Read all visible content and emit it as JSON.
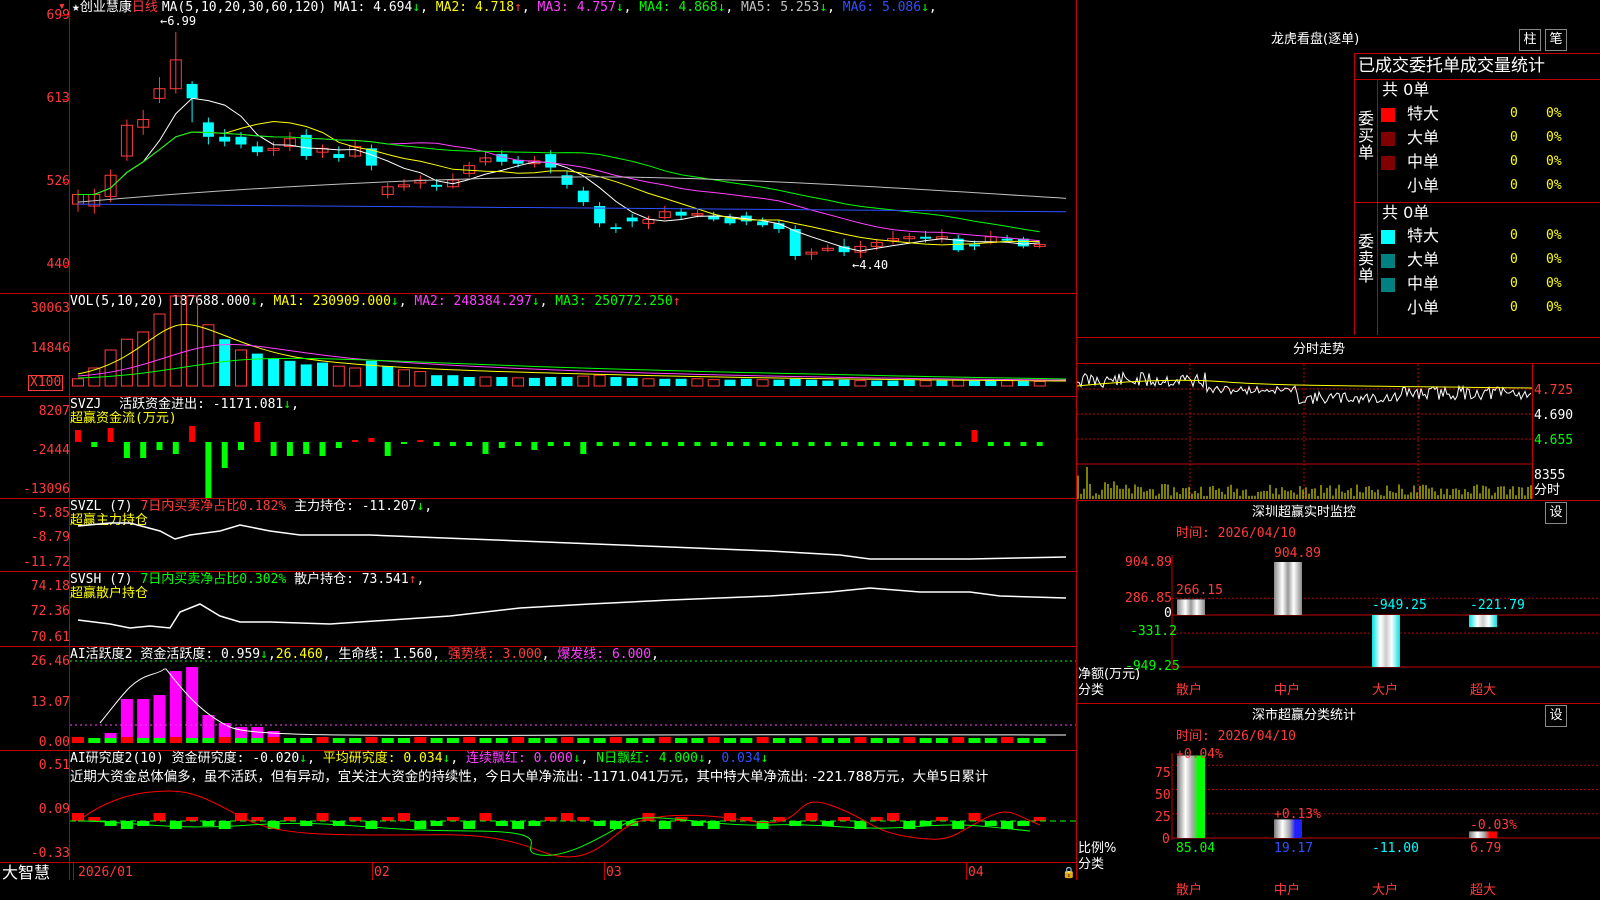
{
  "main": {
    "corner_mark": "▾",
    "y_ticks": [
      "699",
      "613",
      "526",
      "440"
    ],
    "stock_name": "★创业慧康",
    "period": "日线",
    "ma_header": "MA(5,10,20,30,60,120)",
    "ma": [
      {
        "label": "MA1:",
        "value": "4.694",
        "arrow": "↓",
        "color": "#ffffff"
      },
      {
        "label": "MA2:",
        "value": "4.718",
        "arrow": "↑",
        "color": "#ffff00"
      },
      {
        "label": "MA3:",
        "value": "4.757",
        "arrow": "↓",
        "color": "#ff40ff"
      },
      {
        "label": "MA4:",
        "value": "4.868",
        "arrow": "↓",
        "color": "#00ff00"
      },
      {
        "label": "MA5:",
        "value": "5.253",
        "arrow": "↓",
        "color": "#c0c0c0"
      },
      {
        "label": "MA6:",
        "value": "5.086",
        "arrow": "↓",
        "color": "#3050ff"
      }
    ],
    "high_marker": "6.99",
    "low_marker": "4.40"
  },
  "vol": {
    "header": "VOL(5,10,20)",
    "value": "187688.000",
    "value_arrow": "↓",
    "ma1": "MA1: 230909.000",
    "ma1_arrow": "↓",
    "ma2": "MA2: 248384.297",
    "ma2_arrow": "↓",
    "ma3": "MA3: 250772.250",
    "ma3_arrow": "↑",
    "y_ticks": [
      "30063",
      "14846"
    ],
    "unit": "X100"
  },
  "svzj": {
    "header": "SVZJ",
    "label": "活跃资金进出: -1171.081",
    "arrow": "↓",
    "comma": ",",
    "title": "超赢资金流(万元)",
    "y_ticks": [
      "8207",
      "-2444",
      "-13096"
    ]
  },
  "svzl": {
    "header": "SVZL (7)",
    "ratio": "7日内买卖净占比0.182%",
    "hold": "主力持仓: -11.207",
    "arrow": "↓",
    "comma": ",",
    "title": "超赢主力持仓",
    "y_ticks": [
      "-5.85",
      "-8.79",
      "-11.72"
    ]
  },
  "svsh": {
    "header": "SVSH (7)",
    "ratio": "7日内买卖净占比0.302%",
    "hold": "散户持仓: 73.541",
    "arrow": "↑",
    "comma": ",",
    "title": "超赢散户持仓",
    "y_ticks": [
      "74.18",
      "72.36",
      "70.61"
    ]
  },
  "ai1": {
    "header": "AI活跃度2",
    "label": "资金活跃度: 0.959",
    "arrow1": "↓",
    "v2": "26.460",
    "comma": ",",
    "life": "生命线: 1.560",
    "strong": "强势线: 3.000",
    "burst": "爆发线: 6.000",
    "tail": ",",
    "y_ticks": [
      "26.46",
      "13.07",
      "0.00"
    ]
  },
  "ai2": {
    "header": "AI研究度2(10)",
    "label": "资金研究度: -0.020",
    "arrow1": "↓",
    "avg": "平均研究度: 0.034",
    "arrow2": "↓",
    "lianxu": "连续飘红: 0.000",
    "arrow3": "↓",
    "nday": "N日飘红: 4.000",
    "arrow4": "↓",
    "last": "0.034",
    "arrow5": "↓",
    "comment": "近期大资金总体偏多，虽不活跃，但有异动，宜关注大资金的持续性，今日大单净流出: -1171.041万元，其中特大单净流出: -221.788万元，大单5日累计",
    "y_ticks": [
      "0.51",
      "0.09",
      "-0.33"
    ]
  },
  "xaxis": {
    "brand": "大智慧",
    "labels": [
      "2026/01",
      "02",
      "03",
      "04"
    ]
  },
  "lhb": {
    "title": "龙虎看盘(逐单)",
    "btn1": "柱",
    "btn2": "笔",
    "table_title": "已成交委托单成交量统计",
    "buy_side": "委买单",
    "sell_side": "委卖单",
    "buy_total": "共 0单",
    "sell_total": "共 0单",
    "rows": [
      {
        "label": "特大",
        "count": "0",
        "pct": "0%"
      },
      {
        "label": "大单",
        "count": "0",
        "pct": "0%"
      },
      {
        "label": "中单",
        "count": "0",
        "pct": "0%"
      },
      {
        "label": "小单",
        "count": "0",
        "pct": "0%"
      }
    ],
    "buy_colors": [
      "#ff0000",
      "#800000",
      "#800000",
      ""
    ],
    "sell_colors": [
      "#00ffff",
      "#008080",
      "#008080",
      ""
    ]
  },
  "intraday": {
    "title": "分时走势",
    "y_ticks": [
      "4.725",
      "4.690",
      "4.655"
    ],
    "vol_tick": "8355",
    "vol_label": "分时"
  },
  "monitor": {
    "title": "深圳超赢实时监控",
    "set": "设",
    "time": "时间: 2026/04/10",
    "y_ticks": [
      "904.89",
      "286.85",
      "0",
      "-331.2",
      "-949.25"
    ],
    "axis_title": "净额(万元)",
    "cat_label": "分类",
    "categories": [
      "散户",
      "中户",
      "大户",
      "超大"
    ],
    "values": [
      266.15,
      904.89,
      -949.25,
      -221.79
    ],
    "value_labels": [
      "266.15",
      "904.89",
      "-949.25",
      "-221.79"
    ]
  },
  "classify": {
    "title": "深市超赢分类统计",
    "set": "设",
    "time": "时间: 2026/04/10",
    "y_ticks": [
      "75",
      "50",
      "25",
      "0"
    ],
    "axis_title": "比例%",
    "cat_label": "分类",
    "categories": [
      "散户",
      "中户",
      "大户",
      "超大"
    ],
    "bars": [
      85.04,
      19.17,
      0,
      6.79
    ],
    "values": [
      "85.04",
      "19.17",
      "-11.00",
      "6.79"
    ],
    "changes": [
      "+0.04%",
      "+0.13%",
      "",
      "-0.03%"
    ]
  }
}
